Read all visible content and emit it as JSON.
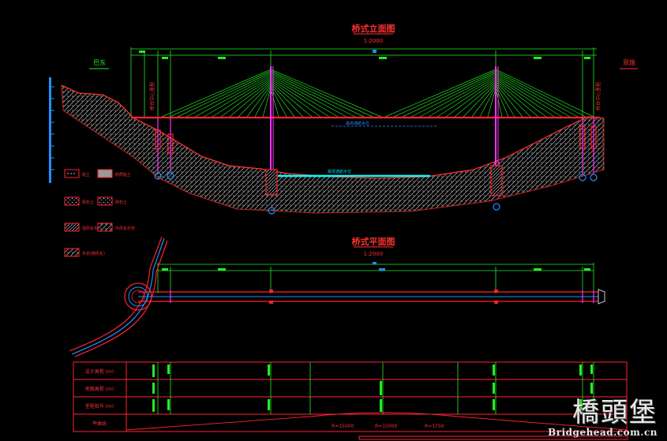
{
  "elevation": {
    "title": "桥式立面图",
    "scale": "1:2000",
    "left_label": "巴东",
    "right_label": "恩施",
    "left_abut_note": "桥台中心里程",
    "right_abut_note": "桥台中心里程",
    "water_level_note": "最高通航水位",
    "low_water_note": "最低通航水位"
  },
  "plan": {
    "title": "桥式平面图",
    "scale": "1:2000"
  },
  "legend": {
    "items": [
      "粘土",
      "粉质粘土",
      "砾石土",
      "碎石土",
      "强风化灰岩",
      "中风化灰岩",
      "灰岩(微风化)"
    ]
  },
  "profile_table": {
    "rows": [
      "设计高程 (m)",
      "地面高程 (m)",
      "里程桩号 (m)",
      "平曲线"
    ],
    "curve_labels": [
      "R=15000",
      "R=15000",
      "R=1750"
    ]
  },
  "watermark": {
    "title": "橋頭堡",
    "url": "Bridgehead.com.cn"
  },
  "colors": {
    "background": "#000000",
    "cable": "#22dd22",
    "deck": "#ff2233",
    "tower": "#ff33ff",
    "dimension": "#22ee22",
    "water": "#00ffff",
    "title": "#ff3030",
    "ground": "#cccccc"
  }
}
